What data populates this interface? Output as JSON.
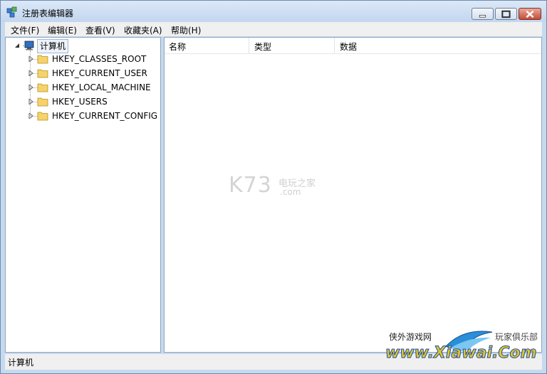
{
  "window": {
    "title": "注册表编辑器"
  },
  "menu": [
    "文件(F)",
    "编辑(E)",
    "查看(V)",
    "收藏夹(A)",
    "帮助(H)"
  ],
  "tree": {
    "root": "计算机",
    "children": [
      "HKEY_CLASSES_ROOT",
      "HKEY_CURRENT_USER",
      "HKEY_LOCAL_MACHINE",
      "HKEY_USERS",
      "HKEY_CURRENT_CONFIG"
    ]
  },
  "list": {
    "columns": [
      "名称",
      "类型",
      "数据"
    ]
  },
  "status": "计算机",
  "watermark": {
    "k73": "K73",
    "k73_sub1": "电玩之家",
    "k73_sub2": ".com"
  },
  "logo": {
    "left_text": "侠外游戏网",
    "right_text": "玩家俱乐部",
    "main": "www.Xiawai.Com"
  }
}
